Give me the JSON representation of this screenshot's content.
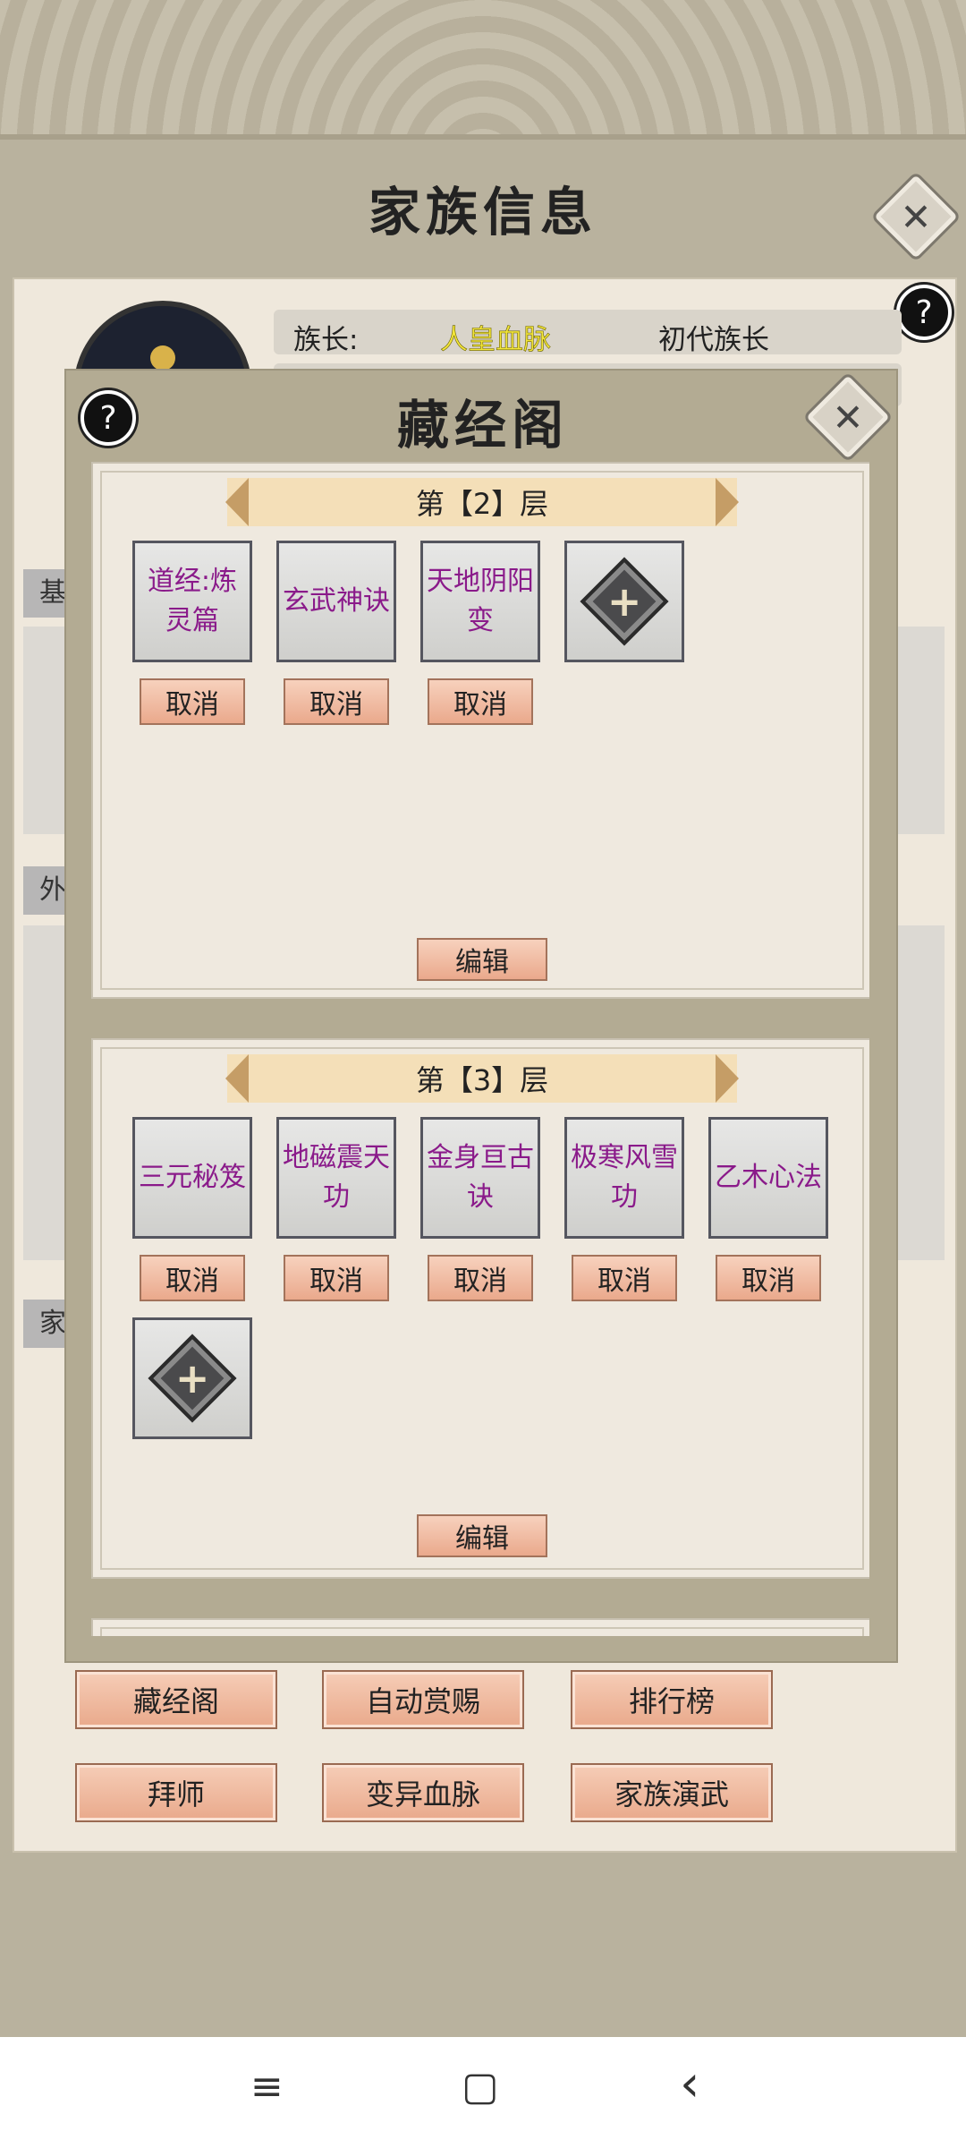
{
  "family": {
    "title": "家族信息",
    "leader_label": "族长:",
    "bloodline": "人皇血脉",
    "leader_rank": "初代族长",
    "side_tabs": [
      "基",
      "外",
      "家"
    ]
  },
  "modal": {
    "title": "藏经阁",
    "floors": [
      {
        "header": "第【2】层",
        "slots": [
          "道经:炼灵篇",
          "玄武神诀",
          "天地阴阳变"
        ],
        "cancel_label": "取消",
        "edit_label": "编辑"
      },
      {
        "header": "第【3】层",
        "slots": [
          "三元秘笈",
          "地磁震天功",
          "金身亘古诀",
          "极寒风雪功",
          "乙木心法"
        ],
        "cancel_label": "取消",
        "edit_label": "编辑"
      }
    ]
  },
  "bottom_buttons": [
    "藏经阁",
    "自动赏赐",
    "排行榜",
    "拜师",
    "变异血脉",
    "家族演武"
  ],
  "help_symbol": "?",
  "close_symbol": "✕",
  "plus_symbol": "+",
  "nav": {
    "menu_icon": "≡",
    "home_icon": "▢",
    "back_icon": "‹"
  },
  "colors": {
    "bloodline": "#f3e63a",
    "skill_text": "#8a1a8a"
  }
}
